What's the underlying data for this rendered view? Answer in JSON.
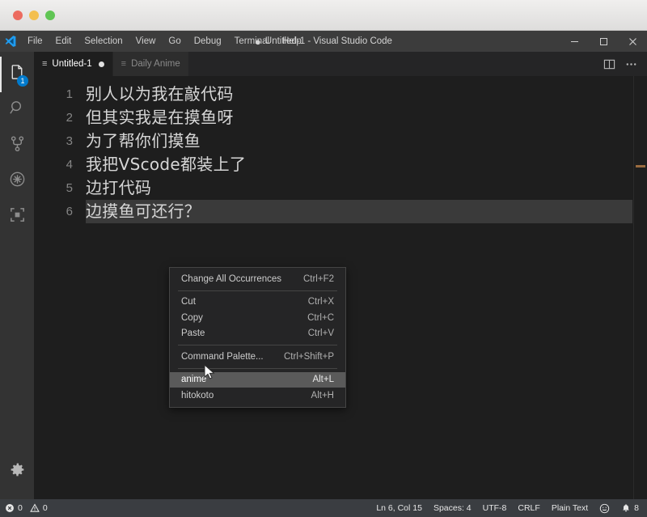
{
  "os_window": {
    "name": "macos-window-frame",
    "traffic_lights": [
      {
        "name": "close",
        "color": "#ec6b5f"
      },
      {
        "name": "minimize",
        "color": "#f3bf4f"
      },
      {
        "name": "maximize",
        "color": "#60c554"
      }
    ]
  },
  "titlebar": {
    "logo": "vscode-logo",
    "window_title": "Untitled-1 - Visual Studio Code",
    "dirty_indicator": "●",
    "menu": [
      {
        "label": "File"
      },
      {
        "label": "Edit"
      },
      {
        "label": "Selection"
      },
      {
        "label": "View"
      },
      {
        "label": "Go"
      },
      {
        "label": "Debug"
      },
      {
        "label": "Terminal"
      },
      {
        "label": "Help"
      }
    ],
    "window_controls": [
      {
        "name": "minimize-button",
        "glyph": "—"
      },
      {
        "name": "maximize-button",
        "glyph": "☐"
      },
      {
        "name": "close-button",
        "glyph": "✕"
      }
    ]
  },
  "activitybar": {
    "items": [
      {
        "name": "explorer",
        "icon": "files-icon",
        "badge": "1",
        "active": true
      },
      {
        "name": "search",
        "icon": "search-icon",
        "badge": "",
        "active": false
      },
      {
        "name": "source-control",
        "icon": "source-control-icon",
        "badge": "",
        "active": false
      },
      {
        "name": "debug",
        "icon": "debug-icon",
        "badge": "",
        "active": false
      },
      {
        "name": "extensions",
        "icon": "extensions-icon",
        "badge": "",
        "active": false
      }
    ],
    "bottom": {
      "name": "manage",
      "icon": "gear-icon"
    }
  },
  "tabs": [
    {
      "label": "Untitled-1",
      "icon": "file-text-icon",
      "active": true,
      "dirty": true
    },
    {
      "label": "Daily Anime",
      "icon": "file-text-icon",
      "active": false,
      "dirty": false
    }
  ],
  "tab_actions": [
    {
      "name": "split-editor-button",
      "icon": "split-editor-icon"
    },
    {
      "name": "more-actions-button",
      "icon": "ellipsis-icon"
    }
  ],
  "editor": {
    "lines": [
      {
        "no": "1",
        "text": "别人以为我在敲代码",
        "selected": false
      },
      {
        "no": "2",
        "text": "但其实我是在摸鱼呀",
        "selected": false
      },
      {
        "no": "3",
        "text": "为了帮你们摸鱼",
        "selected": false
      },
      {
        "no": "4",
        "text": "我把VScode都装上了",
        "selected": false
      },
      {
        "no": "5",
        "text": "边打代码",
        "selected": false
      },
      {
        "no": "6",
        "text": "边摸鱼可还行？",
        "selected": true
      }
    ],
    "overview_marker_color": "#9a6b3f"
  },
  "context_menu": {
    "name": "editor-context-menu",
    "groups": [
      [
        {
          "label": "Change All Occurrences",
          "key": "Ctrl+F2",
          "highlighted": false
        }
      ],
      [
        {
          "label": "Cut",
          "key": "Ctrl+X",
          "highlighted": false
        },
        {
          "label": "Copy",
          "key": "Ctrl+C",
          "highlighted": false
        },
        {
          "label": "Paste",
          "key": "Ctrl+V",
          "highlighted": false
        }
      ],
      [
        {
          "label": "Command Palette...",
          "key": "Ctrl+Shift+P",
          "highlighted": false
        }
      ],
      [
        {
          "label": "anime",
          "key": "Alt+L",
          "highlighted": true
        },
        {
          "label": "hitokoto",
          "key": "Alt+H",
          "highlighted": false
        }
      ]
    ]
  },
  "statusbar": {
    "left": [
      {
        "name": "errors",
        "icon": "error-icon",
        "value": "0"
      },
      {
        "name": "warnings",
        "icon": "warning-icon",
        "value": "0"
      }
    ],
    "right": [
      {
        "name": "cursor-position",
        "value": "Ln 6, Col 15"
      },
      {
        "name": "indentation",
        "value": "Spaces: 4"
      },
      {
        "name": "encoding",
        "value": "UTF-8"
      },
      {
        "name": "eol",
        "value": "CRLF"
      },
      {
        "name": "language-mode",
        "value": "Plain Text"
      },
      {
        "name": "feedback",
        "icon": "smiley-icon",
        "value": ""
      },
      {
        "name": "notifications",
        "icon": "bell-icon",
        "value": "8"
      }
    ]
  },
  "colors": {
    "accent": "#007acc",
    "editor_bg": "#1e1e1e",
    "sidebar_bg": "#333333",
    "statusbar_bg": "#3a3d41",
    "menu_bg": "#3c3c3c",
    "selection": "#3a3a3a"
  }
}
